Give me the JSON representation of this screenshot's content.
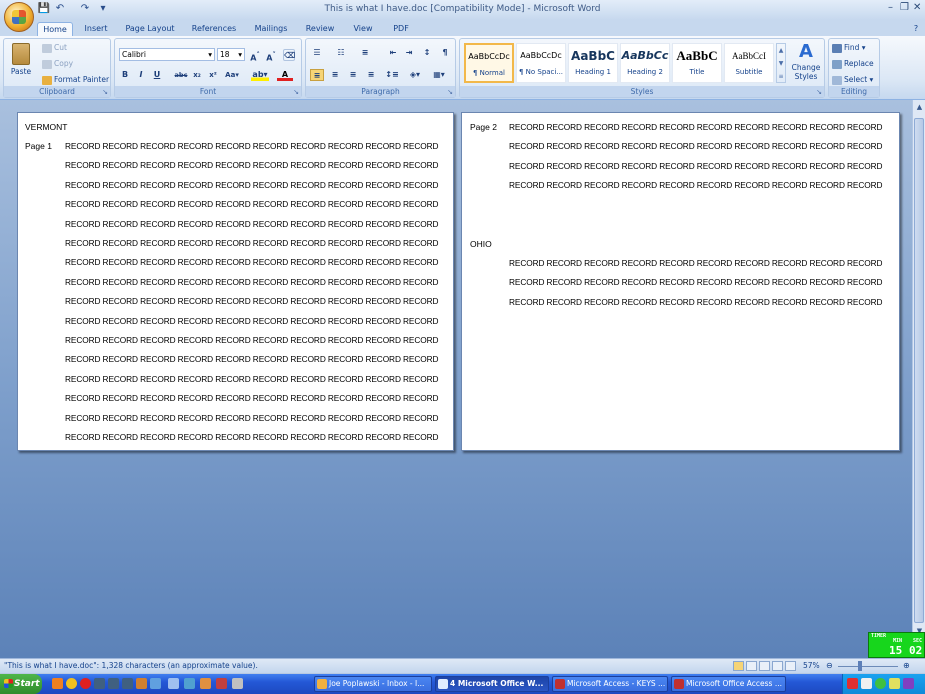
{
  "window": {
    "title": "This is what I have.doc [Compatibility Mode] - Microsoft Word",
    "controls": {
      "minimize": "–",
      "restore": "❐",
      "close": "✕"
    },
    "help_glyph": "?"
  },
  "tabs": [
    "Home",
    "Insert",
    "Page Layout",
    "References",
    "Mailings",
    "Review",
    "View",
    "PDF"
  ],
  "ribbon": {
    "clipboard": {
      "label": "Clipboard",
      "paste": "Paste",
      "cut": "Cut",
      "copy": "Copy",
      "format_painter": "Format Painter"
    },
    "font": {
      "label": "Font",
      "family": "Calibri",
      "size": "18"
    },
    "paragraph": {
      "label": "Paragraph"
    },
    "styles": {
      "label": "Styles",
      "gallery": [
        {
          "preview": "AaBbCcDc",
          "name": "¶ Normal"
        },
        {
          "preview": "AaBbCcDc",
          "name": "¶ No Spaci..."
        },
        {
          "preview": "AaBbC",
          "name": "Heading 1"
        },
        {
          "preview": "AaBbCc",
          "name": "Heading 2"
        },
        {
          "preview": "AaBbC",
          "name": "Title"
        },
        {
          "preview": "AaBbCcI",
          "name": "Subtitle"
        }
      ],
      "change_styles": "Change Styles"
    },
    "editing": {
      "label": "Editing",
      "find": "Find",
      "replace": "Replace",
      "select": "Select"
    }
  },
  "document": {
    "page1": {
      "heading": "VERMONT",
      "page_label": "Page 1",
      "record_line": "RECORD RECORD RECORD RECORD RECORD RECORD RECORD RECORD RECORD RECORD",
      "line_count": 16
    },
    "page2": {
      "page_label": "Page 2",
      "record_line": "RECORD RECORD RECORD RECORD RECORD RECORD RECORD RECORD RECORD RECORD",
      "first_block_lines": 4,
      "heading2": "OHIO",
      "second_block_lines": 3
    }
  },
  "timer": {
    "min_label": "MIN",
    "sec_label": "SEC",
    "label": "TIMER",
    "minutes": "15",
    "seconds": "02"
  },
  "status": {
    "text": "\"This is what I have.doc\": 1,328 characters (an approximate value).",
    "zoom": "57%"
  },
  "taskbar": {
    "start": "Start",
    "tasks": [
      {
        "label": "Joe Poplawski - Inbox - I...",
        "active": false,
        "color": "#f0b040"
      },
      {
        "label": "4 Microsoft Office W...",
        "active": true,
        "color": "#2b5fd0"
      },
      {
        "label": "Microsoft Access - KEYS ...",
        "active": false,
        "color": "#b02020"
      },
      {
        "label": "Microsoft Office Access ...",
        "active": false,
        "color": "#b02020"
      }
    ]
  }
}
